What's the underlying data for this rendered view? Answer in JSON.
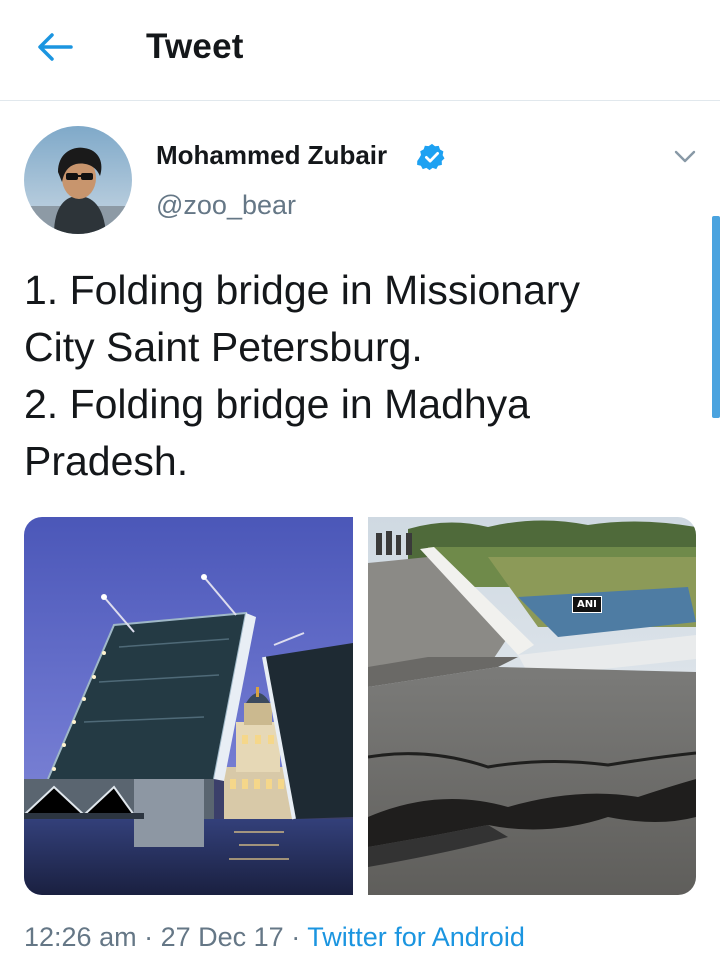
{
  "header": {
    "title": "Tweet"
  },
  "author": {
    "name": "Mohammed Zubair",
    "handle": "@zoo_bear",
    "verified": true
  },
  "tweet": {
    "text": "1. Folding bridge in Missionary\nCity Saint Petersburg.\n2. Folding bridge in Madhya\nPradesh."
  },
  "media": {
    "left_image": "raised bascule bridge at night",
    "right_image": "collapsed road bridge",
    "watermark": "ANI"
  },
  "meta": {
    "time": "12:26 am",
    "date": "27 Dec 17",
    "separator": "·",
    "source": "Twitter for Android"
  },
  "colors": {
    "accent": "#1b95e0",
    "verified": "#1da1f2",
    "secondary_text": "#657786",
    "divider": "#e1e8ed"
  }
}
